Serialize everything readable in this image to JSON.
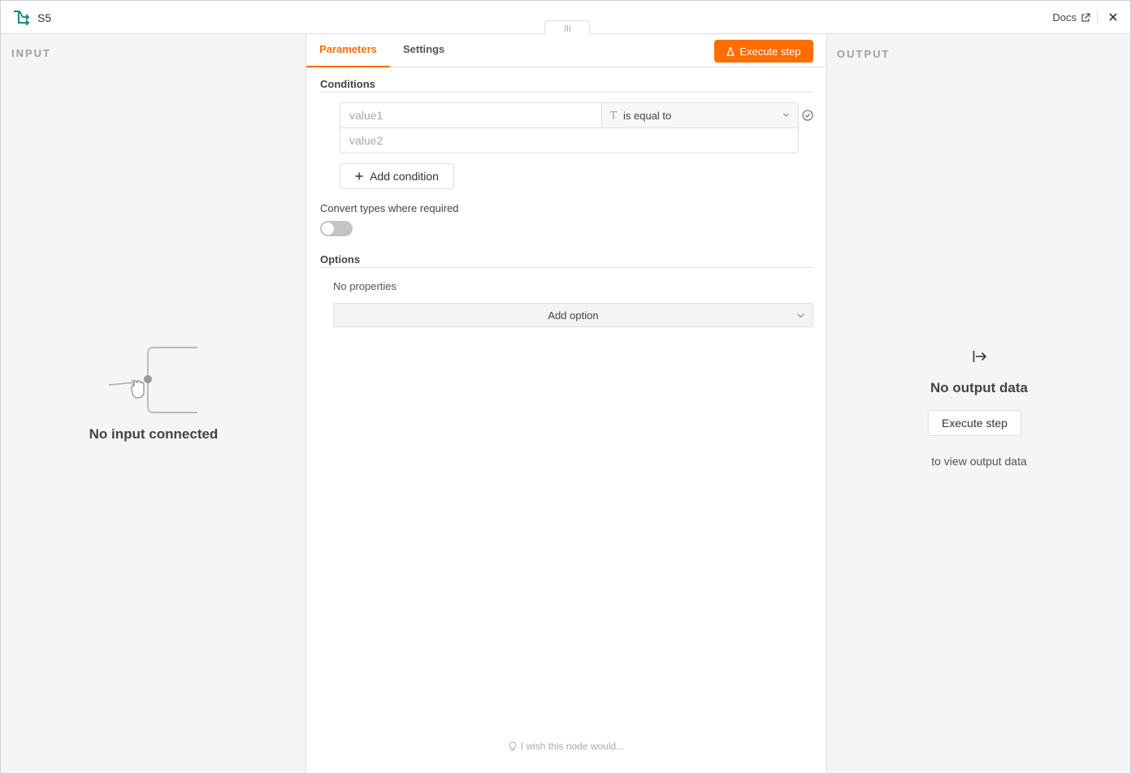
{
  "header": {
    "title": "S5",
    "docs_label": "Docs"
  },
  "input_panel": {
    "label": "INPUT",
    "empty_text": "No input connected"
  },
  "tabs": [
    {
      "label": "Parameters"
    },
    {
      "label": "Settings"
    }
  ],
  "execute_button": {
    "label": "Execute step"
  },
  "conditions": {
    "title": "Conditions",
    "value1_placeholder": "value1",
    "operator_type_icon": "T",
    "operator_label": "is equal to",
    "value2_placeholder": "value2",
    "add_condition_label": "Add condition"
  },
  "convert_types": {
    "label": "Convert types where required",
    "enabled": false
  },
  "options": {
    "title": "Options",
    "no_properties": "No properties",
    "add_option_label": "Add option"
  },
  "feedback": {
    "label": "I wish this node would..."
  },
  "output_panel": {
    "label": "OUTPUT",
    "empty_title": "No output data",
    "execute_label": "Execute step",
    "hint": "to view output data"
  },
  "colors": {
    "accent": "#ff6d00",
    "node_icon": "#1a8a7a"
  }
}
